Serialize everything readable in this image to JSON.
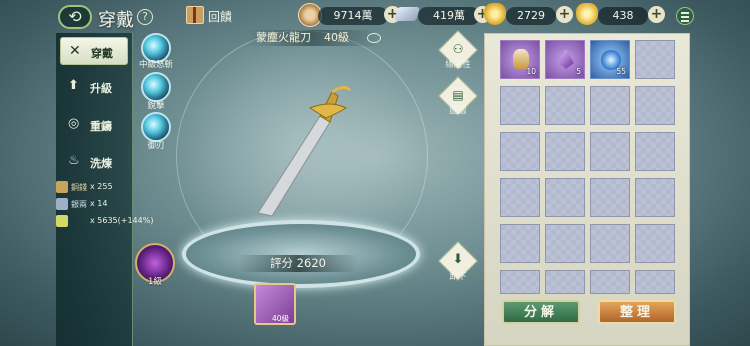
{
  "header": {
    "title": "穿戴",
    "gift_label": "回饋",
    "resources": [
      {
        "icon": "copper-coin-icon",
        "value": "9714萬"
      },
      {
        "icon": "silver-ingot-icon",
        "value": "419萬"
      },
      {
        "icon": "gold-ingot-icon",
        "value": "2729"
      },
      {
        "icon": "gold-ingot-icon",
        "value": "438"
      }
    ]
  },
  "nav": {
    "items": [
      {
        "label": "穿戴",
        "icon": "crossed-swords-icon",
        "active": true
      },
      {
        "label": "升級",
        "icon": "arrow-up-icon",
        "active": false
      },
      {
        "label": "重鑄",
        "icon": "swirl-icon",
        "active": false
      },
      {
        "label": "洗煉",
        "icon": "refine-icon",
        "active": false
      }
    ]
  },
  "materials": [
    {
      "name": "銅錢",
      "qty": "x 255",
      "color": "#c9a45a"
    },
    {
      "name": "銀兩",
      "qty": "x 14",
      "color": "#9fb0c6"
    },
    {
      "name": "",
      "qty": "x 5635(+144%)",
      "color": "#d3d868"
    }
  ],
  "skills": [
    {
      "label": "中級怒斬"
    },
    {
      "label": "銳擊"
    },
    {
      "label": "御刃"
    }
  ],
  "weapon": {
    "name": "蒙塵火龍刀",
    "level": "40級",
    "score": "評分 2620"
  },
  "level_orb": {
    "label": "1級"
  },
  "equipped_slot": {
    "label": "40級"
  },
  "side_buttons": {
    "total_attr": "總屬性",
    "codex": "圖鑑",
    "unequip": "卸下"
  },
  "inventory": {
    "items": [
      {
        "count": "10",
        "type": "potion"
      },
      {
        "count": "5",
        "type": "crystal"
      },
      {
        "count": "55",
        "type": "orb"
      }
    ],
    "decompose_label": "分解",
    "sort_label": "整理"
  }
}
